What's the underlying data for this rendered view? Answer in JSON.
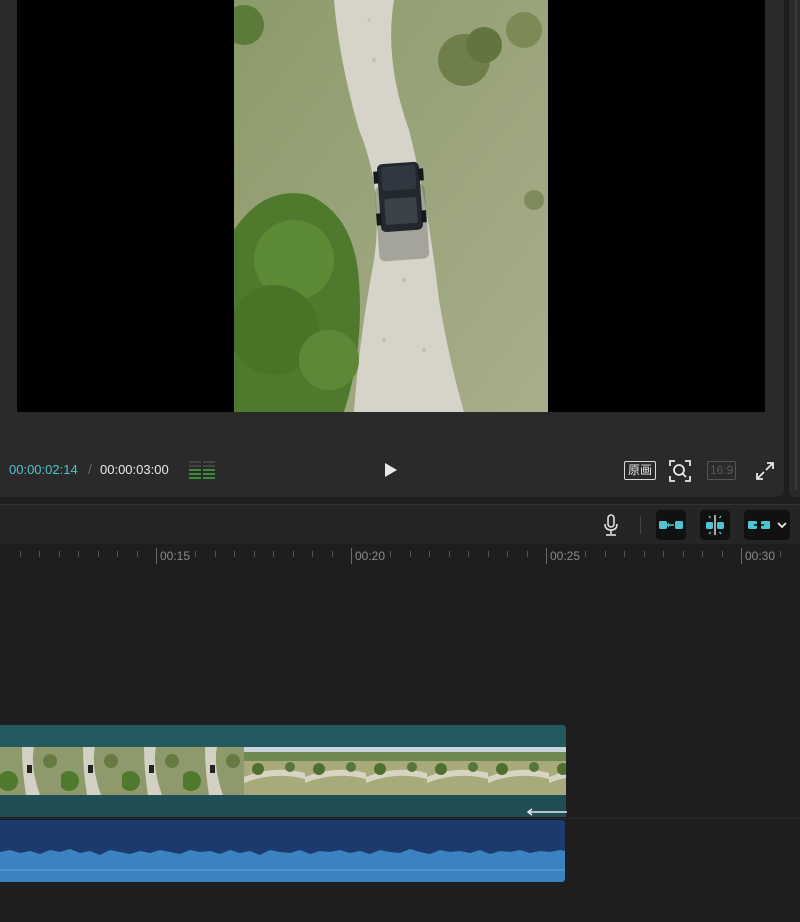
{
  "player": {
    "current_time": "00:00:02:14",
    "separator": "/",
    "total_time": "00:00:03:00",
    "original_label": "原画",
    "ratio_label": "16:9"
  },
  "icons": {
    "play": "play-icon",
    "zoom": "zoom-icon",
    "fullscreen": "fullscreen-icon",
    "mic": "microphone-icon",
    "audio_meter": "audio-meter-icon",
    "tool1": "link-left-icon",
    "tool2": "split-snap-icon",
    "tool3": "link-clip-icon",
    "dropdown": "chevron-down-icon"
  },
  "ruler": {
    "labels": [
      "00:15",
      "00:20",
      "00:25",
      "00:30"
    ]
  },
  "colors": {
    "accent": "#4fc3cf",
    "video_track": "#1f4f55",
    "audio_track": "#1c3a6b",
    "waveform": "#3b83c0"
  }
}
